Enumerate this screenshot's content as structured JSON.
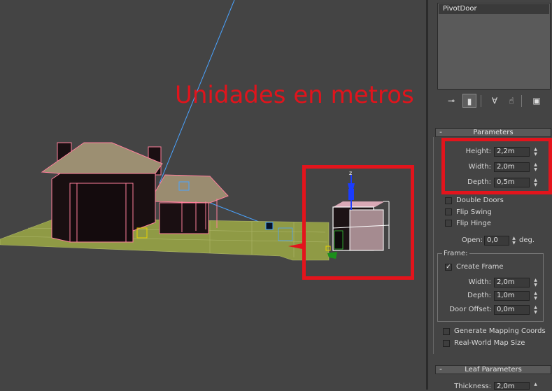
{
  "annotation": {
    "text": "Unidades en metros",
    "color": "#e0141c"
  },
  "object_name": "PivotDoor",
  "command_tabs": [
    "create-tab",
    "modify-tab",
    "hierarchy-tab",
    "motion-tab",
    "display-tab",
    "utilities-tab"
  ],
  "parameters": {
    "title": "Parameters",
    "collapse": "-",
    "height": {
      "label": "Height:",
      "value": "2,2m"
    },
    "width": {
      "label": "Width:",
      "value": "2,0m"
    },
    "depth": {
      "label": "Depth:",
      "value": "0,5m"
    },
    "double_doors": "Double Doors",
    "flip_swing": "Flip Swing",
    "flip_hinge": "Flip Hinge",
    "open": {
      "label": "Open:",
      "value": "0,0",
      "unit": "deg."
    }
  },
  "frame": {
    "title": "Frame:",
    "create_frame": "Create Frame",
    "create_frame_checked": true,
    "width": {
      "label": "Width:",
      "value": "2,0m"
    },
    "depth": {
      "label": "Depth:",
      "value": "1,0m"
    },
    "door_offset": {
      "label": "Door Offset:",
      "value": "0,0m"
    }
  },
  "mapping": {
    "generate": "Generate Mapping Coords",
    "real_world": "Real-World Map Size"
  },
  "leaf": {
    "title": "Leaf Parameters",
    "collapse": "-",
    "thickness": {
      "label": "Thickness:",
      "value": "2,0m"
    }
  },
  "colors": {
    "highlight_red": "#e3141c",
    "viewport_bg": "#444444",
    "wire_pink": "#ff7f9b"
  }
}
